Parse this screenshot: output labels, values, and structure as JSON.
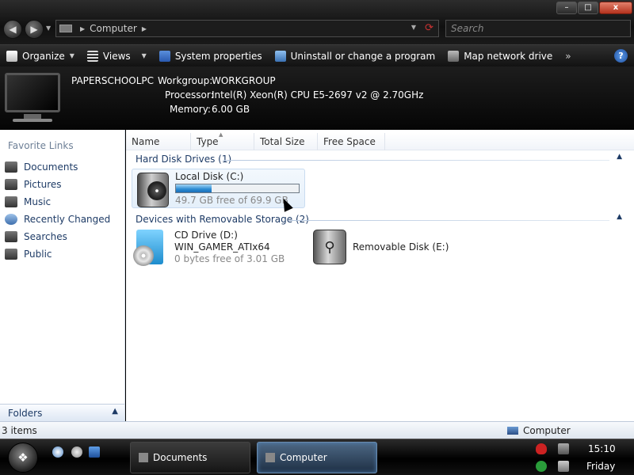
{
  "window": {
    "address": {
      "location": "Computer"
    },
    "search": {
      "placeholder": "Search"
    },
    "controls": {
      "minimize": "–",
      "maximize": "□",
      "close": "x"
    }
  },
  "commandbar": {
    "organize": "Organize",
    "views": "Views",
    "system_properties": "System properties",
    "uninstall": "Uninstall or change a program",
    "map_drive": "Map network drive",
    "more": "»",
    "help": "?"
  },
  "details": {
    "computer_name": "PAPERSCHOOLPC",
    "workgroup_label": "Workgroup:",
    "workgroup": "WORKGROUP",
    "processor_label": "Processor:",
    "processor": "Intel(R) Xeon(R) CPU E5-2697 v2 @ 2.70GHz",
    "memory_label": "Memory:",
    "memory": "6.00 GB"
  },
  "navpane": {
    "favorites_title": "Favorite Links",
    "items": [
      {
        "label": "Documents"
      },
      {
        "label": "Pictures"
      },
      {
        "label": "Music"
      },
      {
        "label": "Recently Changed"
      },
      {
        "label": "Searches"
      },
      {
        "label": "Public"
      }
    ],
    "folders_label": "Folders"
  },
  "columns": {
    "name": "Name",
    "type": "Type",
    "total_size": "Total Size",
    "free_space": "Free Space"
  },
  "groups": {
    "hard_disks": {
      "title": "Hard Disk Drives (1)",
      "drives": [
        {
          "name": "Local Disk (C:)",
          "free_text": "49.7 GB free of 69.9 GB",
          "used_fraction": 0.29
        }
      ]
    },
    "removable": {
      "title": "Devices with Removable Storage (2)",
      "cd": {
        "name": "CD Drive (D:)",
        "label": "WIN_GAMER_ATIx64",
        "free_text": "0 bytes free of 3.01 GB"
      },
      "usb": {
        "name": "Removable Disk (E:)"
      }
    }
  },
  "statusbar": {
    "count": "3 items",
    "location": "Computer"
  },
  "taskbar": {
    "start": "❖",
    "tasks": [
      {
        "label": "Documents"
      },
      {
        "label": "Computer"
      }
    ],
    "clock": {
      "time": "15:10",
      "day": "Friday"
    }
  }
}
